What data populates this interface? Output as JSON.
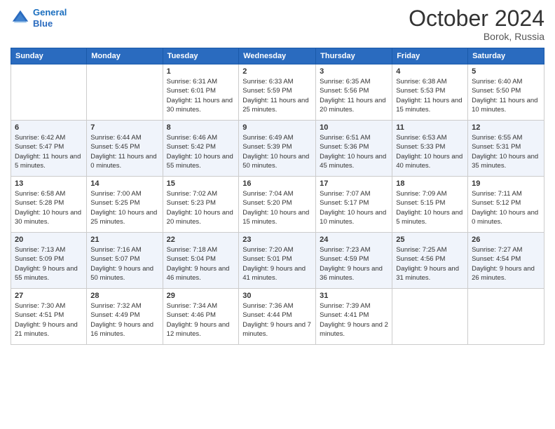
{
  "header": {
    "logo_line1": "General",
    "logo_line2": "Blue",
    "month": "October 2024",
    "location": "Borok, Russia"
  },
  "days_of_week": [
    "Sunday",
    "Monday",
    "Tuesday",
    "Wednesday",
    "Thursday",
    "Friday",
    "Saturday"
  ],
  "weeks": [
    [
      {
        "day": "",
        "info": ""
      },
      {
        "day": "",
        "info": ""
      },
      {
        "day": "1",
        "sunrise": "Sunrise: 6:31 AM",
        "sunset": "Sunset: 6:01 PM",
        "daylight": "Daylight: 11 hours and 30 minutes."
      },
      {
        "day": "2",
        "sunrise": "Sunrise: 6:33 AM",
        "sunset": "Sunset: 5:59 PM",
        "daylight": "Daylight: 11 hours and 25 minutes."
      },
      {
        "day": "3",
        "sunrise": "Sunrise: 6:35 AM",
        "sunset": "Sunset: 5:56 PM",
        "daylight": "Daylight: 11 hours and 20 minutes."
      },
      {
        "day": "4",
        "sunrise": "Sunrise: 6:38 AM",
        "sunset": "Sunset: 5:53 PM",
        "daylight": "Daylight: 11 hours and 15 minutes."
      },
      {
        "day": "5",
        "sunrise": "Sunrise: 6:40 AM",
        "sunset": "Sunset: 5:50 PM",
        "daylight": "Daylight: 11 hours and 10 minutes."
      }
    ],
    [
      {
        "day": "6",
        "sunrise": "Sunrise: 6:42 AM",
        "sunset": "Sunset: 5:47 PM",
        "daylight": "Daylight: 11 hours and 5 minutes."
      },
      {
        "day": "7",
        "sunrise": "Sunrise: 6:44 AM",
        "sunset": "Sunset: 5:45 PM",
        "daylight": "Daylight: 11 hours and 0 minutes."
      },
      {
        "day": "8",
        "sunrise": "Sunrise: 6:46 AM",
        "sunset": "Sunset: 5:42 PM",
        "daylight": "Daylight: 10 hours and 55 minutes."
      },
      {
        "day": "9",
        "sunrise": "Sunrise: 6:49 AM",
        "sunset": "Sunset: 5:39 PM",
        "daylight": "Daylight: 10 hours and 50 minutes."
      },
      {
        "day": "10",
        "sunrise": "Sunrise: 6:51 AM",
        "sunset": "Sunset: 5:36 PM",
        "daylight": "Daylight: 10 hours and 45 minutes."
      },
      {
        "day": "11",
        "sunrise": "Sunrise: 6:53 AM",
        "sunset": "Sunset: 5:33 PM",
        "daylight": "Daylight: 10 hours and 40 minutes."
      },
      {
        "day": "12",
        "sunrise": "Sunrise: 6:55 AM",
        "sunset": "Sunset: 5:31 PM",
        "daylight": "Daylight: 10 hours and 35 minutes."
      }
    ],
    [
      {
        "day": "13",
        "sunrise": "Sunrise: 6:58 AM",
        "sunset": "Sunset: 5:28 PM",
        "daylight": "Daylight: 10 hours and 30 minutes."
      },
      {
        "day": "14",
        "sunrise": "Sunrise: 7:00 AM",
        "sunset": "Sunset: 5:25 PM",
        "daylight": "Daylight: 10 hours and 25 minutes."
      },
      {
        "day": "15",
        "sunrise": "Sunrise: 7:02 AM",
        "sunset": "Sunset: 5:23 PM",
        "daylight": "Daylight: 10 hours and 20 minutes."
      },
      {
        "day": "16",
        "sunrise": "Sunrise: 7:04 AM",
        "sunset": "Sunset: 5:20 PM",
        "daylight": "Daylight: 10 hours and 15 minutes."
      },
      {
        "day": "17",
        "sunrise": "Sunrise: 7:07 AM",
        "sunset": "Sunset: 5:17 PM",
        "daylight": "Daylight: 10 hours and 10 minutes."
      },
      {
        "day": "18",
        "sunrise": "Sunrise: 7:09 AM",
        "sunset": "Sunset: 5:15 PM",
        "daylight": "Daylight: 10 hours and 5 minutes."
      },
      {
        "day": "19",
        "sunrise": "Sunrise: 7:11 AM",
        "sunset": "Sunset: 5:12 PM",
        "daylight": "Daylight: 10 hours and 0 minutes."
      }
    ],
    [
      {
        "day": "20",
        "sunrise": "Sunrise: 7:13 AM",
        "sunset": "Sunset: 5:09 PM",
        "daylight": "Daylight: 9 hours and 55 minutes."
      },
      {
        "day": "21",
        "sunrise": "Sunrise: 7:16 AM",
        "sunset": "Sunset: 5:07 PM",
        "daylight": "Daylight: 9 hours and 50 minutes."
      },
      {
        "day": "22",
        "sunrise": "Sunrise: 7:18 AM",
        "sunset": "Sunset: 5:04 PM",
        "daylight": "Daylight: 9 hours and 46 minutes."
      },
      {
        "day": "23",
        "sunrise": "Sunrise: 7:20 AM",
        "sunset": "Sunset: 5:01 PM",
        "daylight": "Daylight: 9 hours and 41 minutes."
      },
      {
        "day": "24",
        "sunrise": "Sunrise: 7:23 AM",
        "sunset": "Sunset: 4:59 PM",
        "daylight": "Daylight: 9 hours and 36 minutes."
      },
      {
        "day": "25",
        "sunrise": "Sunrise: 7:25 AM",
        "sunset": "Sunset: 4:56 PM",
        "daylight": "Daylight: 9 hours and 31 minutes."
      },
      {
        "day": "26",
        "sunrise": "Sunrise: 7:27 AM",
        "sunset": "Sunset: 4:54 PM",
        "daylight": "Daylight: 9 hours and 26 minutes."
      }
    ],
    [
      {
        "day": "27",
        "sunrise": "Sunrise: 7:30 AM",
        "sunset": "Sunset: 4:51 PM",
        "daylight": "Daylight: 9 hours and 21 minutes."
      },
      {
        "day": "28",
        "sunrise": "Sunrise: 7:32 AM",
        "sunset": "Sunset: 4:49 PM",
        "daylight": "Daylight: 9 hours and 16 minutes."
      },
      {
        "day": "29",
        "sunrise": "Sunrise: 7:34 AM",
        "sunset": "Sunset: 4:46 PM",
        "daylight": "Daylight: 9 hours and 12 minutes."
      },
      {
        "day": "30",
        "sunrise": "Sunrise: 7:36 AM",
        "sunset": "Sunset: 4:44 PM",
        "daylight": "Daylight: 9 hours and 7 minutes."
      },
      {
        "day": "31",
        "sunrise": "Sunrise: 7:39 AM",
        "sunset": "Sunset: 4:41 PM",
        "daylight": "Daylight: 9 hours and 2 minutes."
      },
      {
        "day": "",
        "info": ""
      },
      {
        "day": "",
        "info": ""
      }
    ]
  ]
}
